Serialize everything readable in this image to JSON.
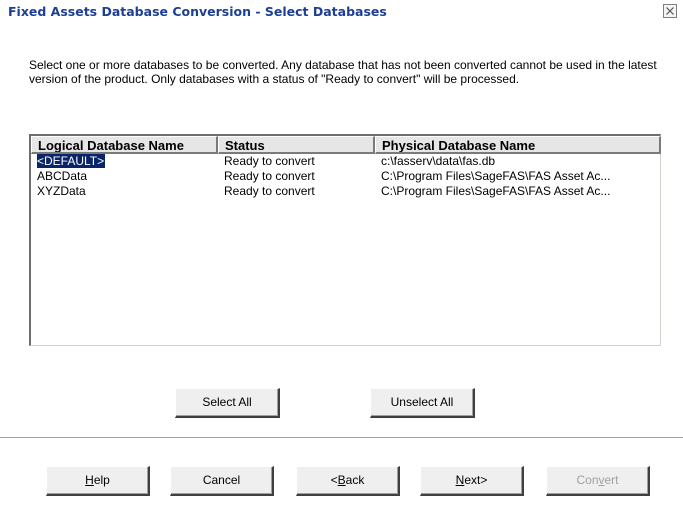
{
  "window": {
    "title": "Fixed Assets Database Conversion - Select Databases"
  },
  "intro_text": "Select one or more databases to be converted. Any database that has not been converted cannot be used in the latest version of the product. Only databases with a status of \"Ready to convert\" will be processed.",
  "list": {
    "columns": [
      "Logical Database Name",
      "Status",
      "Physical Database Name"
    ],
    "rows": [
      {
        "logical": "<DEFAULT>",
        "status": "Ready to convert",
        "physical": "c:\\fasserv\\data\\fas.db",
        "selected": true
      },
      {
        "logical": "ABCData",
        "status": "Ready to convert",
        "physical": "C:\\Program Files\\SageFAS\\FAS Asset Ac...",
        "selected": false
      },
      {
        "logical": "XYZData",
        "status": "Ready to convert",
        "physical": "C:\\Program Files\\SageFAS\\FAS Asset Ac...",
        "selected": false
      }
    ]
  },
  "buttons": {
    "select_all": "Select All",
    "unselect_all": "Unselect All",
    "help_pre": "",
    "help_u": "H",
    "help_post": "elp",
    "cancel": "Cancel",
    "back_pre": "<",
    "back_u": "B",
    "back_post": "ack",
    "next_pre": "",
    "next_u": "N",
    "next_post": "ext>",
    "convert_pre": "Con",
    "convert_u": "v",
    "convert_post": "ert"
  },
  "icons": {
    "close": "close-icon"
  },
  "colors": {
    "title_text": "#1c3f94",
    "selection": "#0a246a",
    "disabled_text": "#a0a0a0"
  }
}
